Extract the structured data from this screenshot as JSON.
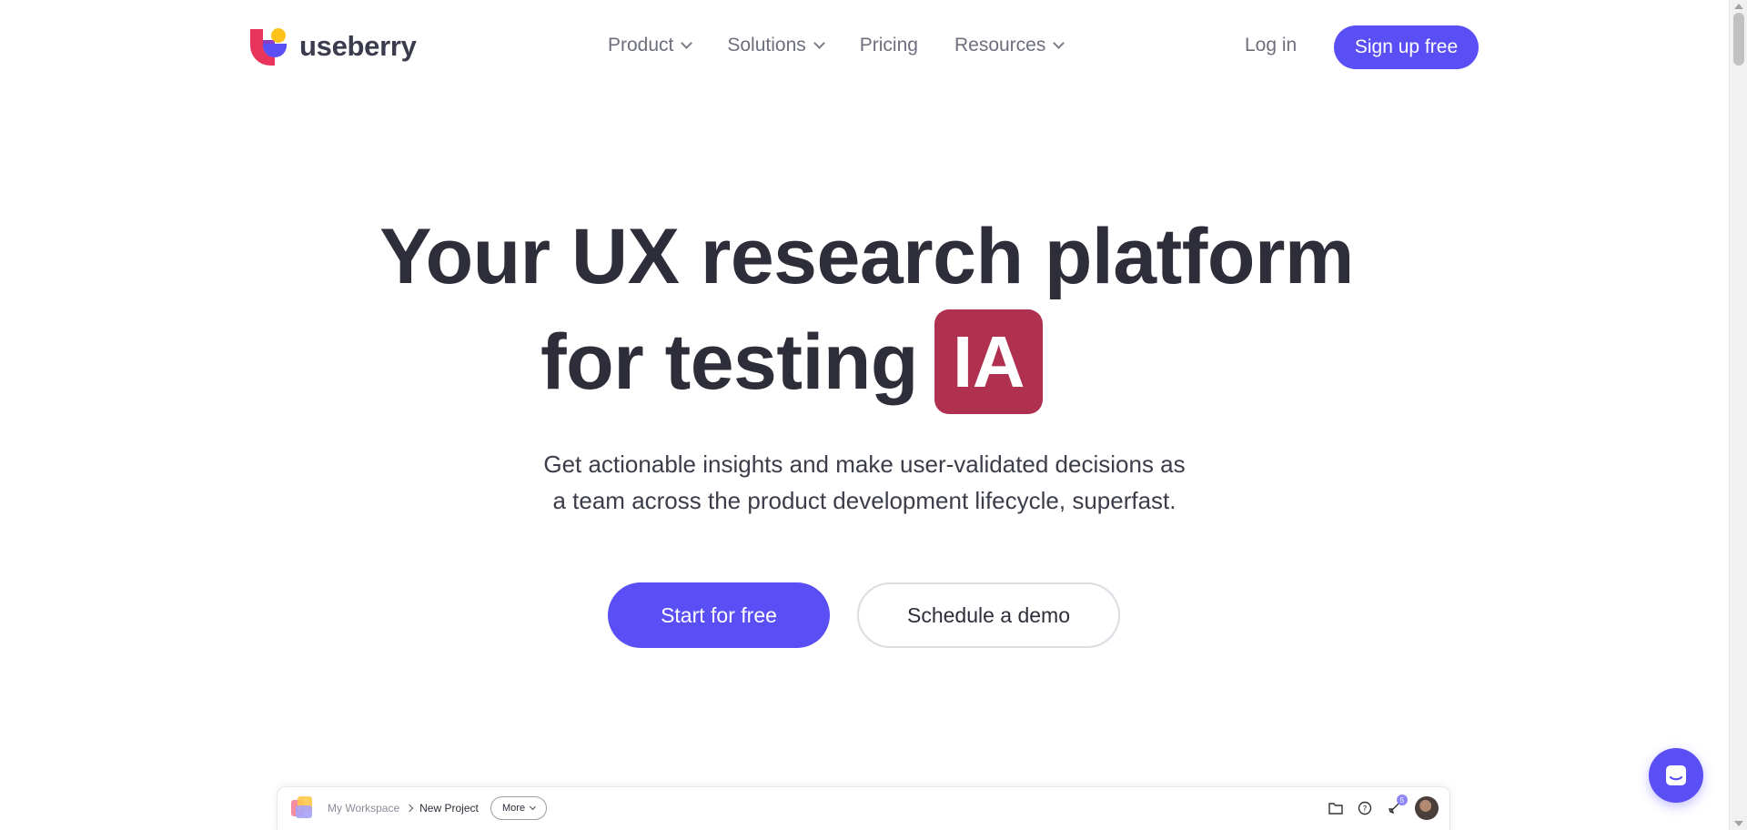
{
  "brand": {
    "name": "useberry"
  },
  "nav": {
    "items": [
      {
        "label": "Product",
        "has_dropdown": true
      },
      {
        "label": "Solutions",
        "has_dropdown": true
      },
      {
        "label": "Pricing",
        "has_dropdown": false
      },
      {
        "label": "Resources",
        "has_dropdown": true
      }
    ],
    "login": "Log in",
    "signup": "Sign up free"
  },
  "hero": {
    "title_line1": "Your UX research platform",
    "title_line2": "for testing",
    "badge": "IA",
    "subtitle_line1": "Get actionable insights and make user-validated decisions as",
    "subtitle_line2": "a team across the product development lifecycle, superfast.",
    "cta_primary": "Start for free",
    "cta_secondary": "Schedule a demo"
  },
  "preview": {
    "breadcrumb": [
      "My Workspace",
      "New Project"
    ],
    "more_label": "More",
    "notification_count": "5"
  },
  "colors": {
    "accent": "#5a4ef5",
    "badge": "#b0304f",
    "text": "#2d2e3a"
  },
  "icons": [
    "logo-mark",
    "chevron-down-icon",
    "folder-icon",
    "help-icon",
    "rocket-icon",
    "avatar",
    "chat-icon"
  ]
}
